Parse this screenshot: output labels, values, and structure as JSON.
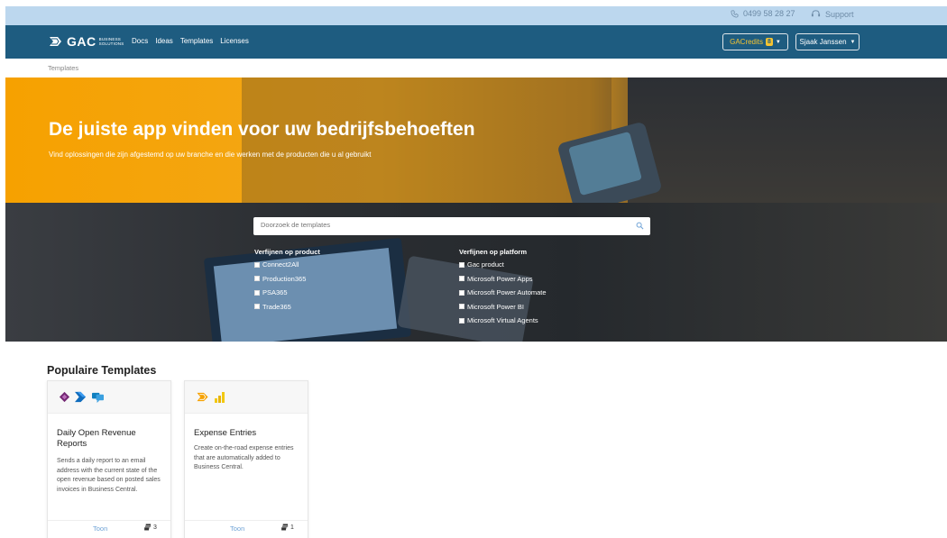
{
  "utilbar": {
    "phone": "0499 58 28 27",
    "support": "Support"
  },
  "navbar": {
    "brand": "GAC",
    "brand_sub_1": "BUSINESS",
    "brand_sub_2": "SOLUTIONS",
    "links": [
      "Docs",
      "Ideas",
      "Templates",
      "Licenses"
    ],
    "credits_label": "GACredits",
    "credits_count": "8",
    "user_name": "Sjaak Janssen"
  },
  "breadcrumb": "Templates",
  "hero": {
    "title": "De juiste app vinden voor uw bedrijfsbehoeften",
    "subtitle": "Vind oplossingen die zijn afgestemd op uw branche en die werken met de producten die u al gebruikt"
  },
  "search": {
    "placeholder": "Doorzoek de templates",
    "product_filter_title": "Verfijnen op product",
    "products": [
      "Connect2All",
      "Production365",
      "PSA365",
      "Trade365"
    ],
    "platform_filter_title": "Verfijnen op platform",
    "platforms": [
      "Gac product",
      "Microsoft Power Apps",
      "Microsoft Power Automate",
      "Microsoft Power BI",
      "Microsoft Virtual Agents"
    ]
  },
  "popular": {
    "title": "Populaire Templates",
    "cards": [
      {
        "icons": [
          "power-apps-icon",
          "power-automate-icon",
          "virtual-agents-icon"
        ],
        "title": "Daily Open Revenue Reports",
        "description": "Sends a daily report to an email address with the current state of the open revenue based on posted sales invoices in Business Central.",
        "link": "Toon",
        "count": "3"
      },
      {
        "icons": [
          "gac-icon",
          "power-bi-icon"
        ],
        "title": "Expense Entries",
        "description": "Create on-the-road expense entries that are automatically added to Business Central.",
        "link": "Toon",
        "count": "1"
      }
    ]
  },
  "colors": {
    "navbar": "#1e5c80",
    "utilbar": "#bcd7ee",
    "hero_orange": "#f6a100",
    "credits_yellow": "#f6c431",
    "link_blue": "#6fa3d6"
  }
}
